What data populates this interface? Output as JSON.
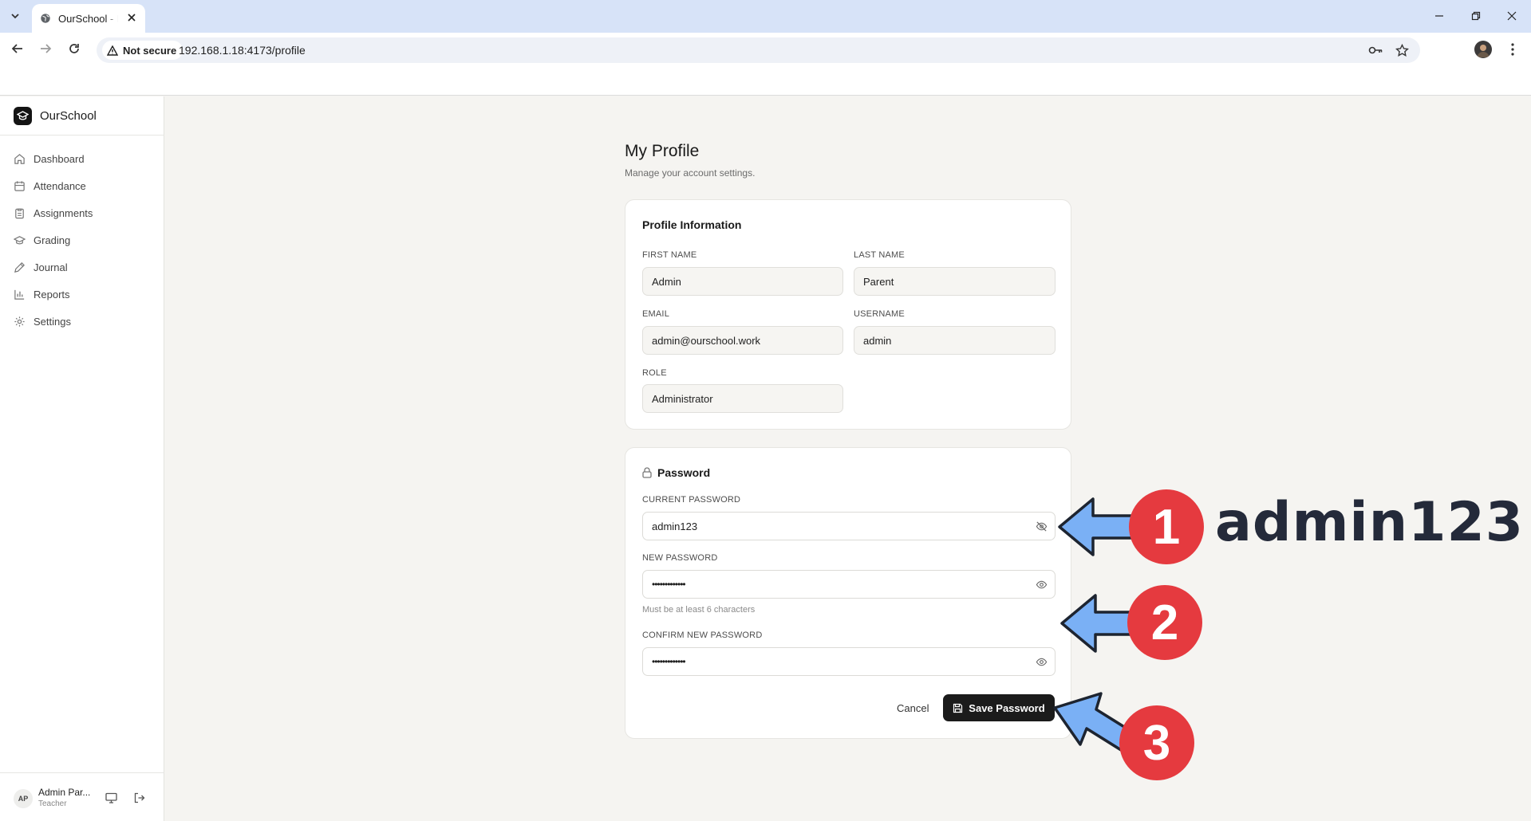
{
  "browser": {
    "tab_title": "OurSchool - Ho",
    "security_label": "Not secure",
    "url": "192.168.1.18:4173/profile"
  },
  "sidebar": {
    "brand": "OurSchool",
    "items": [
      {
        "label": "Dashboard",
        "icon": "home-icon"
      },
      {
        "label": "Attendance",
        "icon": "calendar-icon"
      },
      {
        "label": "Assignments",
        "icon": "clipboard-icon"
      },
      {
        "label": "Grading",
        "icon": "graduation-cap-icon"
      },
      {
        "label": "Journal",
        "icon": "pen-icon"
      },
      {
        "label": "Reports",
        "icon": "bar-chart-icon"
      },
      {
        "label": "Settings",
        "icon": "gear-icon"
      }
    ],
    "user": {
      "initials": "AP",
      "name": "Admin Par...",
      "role": "Teacher"
    }
  },
  "page": {
    "title": "My Profile",
    "subtitle": "Manage your account settings."
  },
  "profile": {
    "title": "Profile Information",
    "first_name_label": "FIRST NAME",
    "first_name": "Admin",
    "last_name_label": "LAST NAME",
    "last_name": "Parent",
    "email_label": "EMAIL",
    "email": "admin@ourschool.work",
    "username_label": "USERNAME",
    "username": "admin",
    "role_label": "ROLE",
    "role": "Administrator"
  },
  "password": {
    "title": "Password",
    "current_label": "CURRENT PASSWORD",
    "current_value": "admin123",
    "new_label": "NEW PASSWORD",
    "new_value": "•••••••••••••",
    "hint": "Must be at least 6 characters",
    "confirm_label": "CONFIRM NEW PASSWORD",
    "confirm_value": "•••••••••••••",
    "cancel_label": "Cancel",
    "save_label": "Save Password"
  },
  "annotations": {
    "badge_1": "1",
    "badge_2": "2",
    "badge_3": "3",
    "callout_text": "admin123",
    "arrow_color": "#7ab0f5",
    "badge_color": "#e53a3f"
  }
}
